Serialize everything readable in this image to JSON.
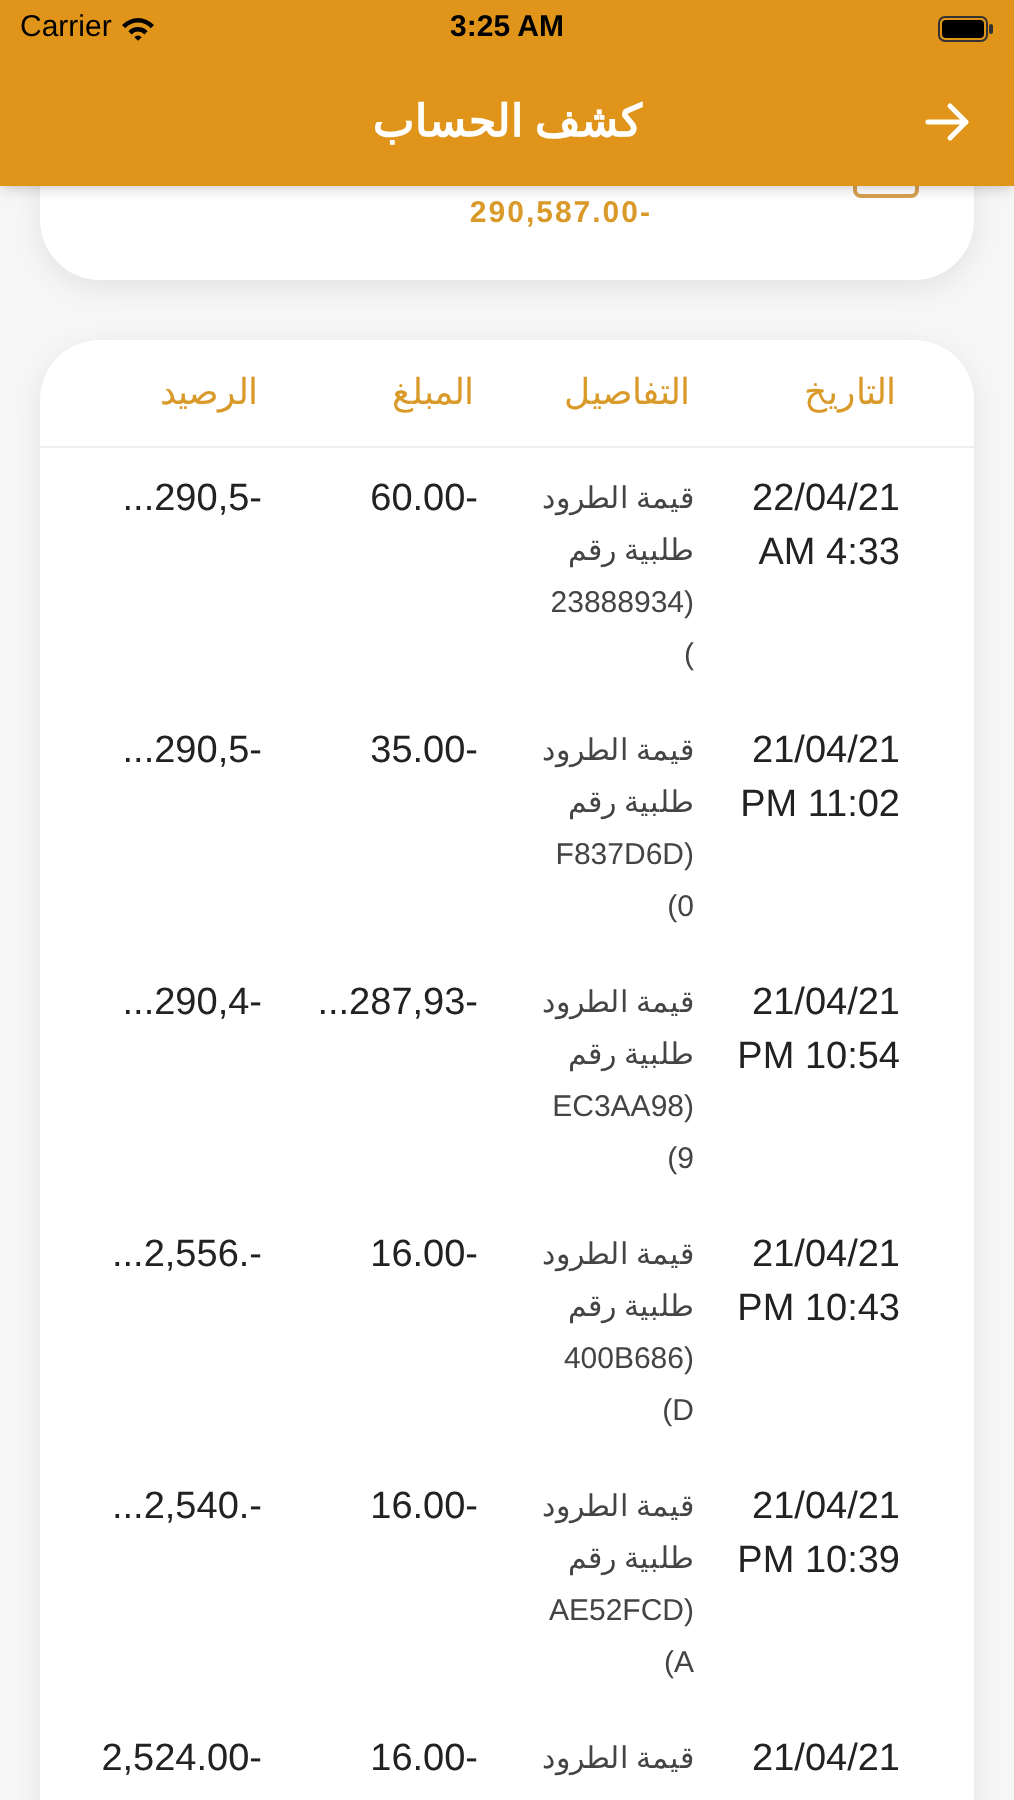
{
  "status_bar": {
    "carrier": "Carrier",
    "time": "3:25 AM"
  },
  "nav": {
    "title": "كشف الحساب"
  },
  "summary": {
    "amount": "290,587.00-"
  },
  "table": {
    "columns": [
      "التاريخ",
      "التفاصيل",
      "المبلغ",
      "الرصيد"
    ],
    "rows": [
      {
        "date": [
          "22/04/21",
          "AM 4:33"
        ],
        "details": [
          "قيمة الطرود",
          "طلبية رقم",
          "23888934)",
          "("
        ],
        "amount": "60.00-",
        "balance": "...290,5-"
      },
      {
        "date": [
          "21/04/21",
          "PM 11:02"
        ],
        "details": [
          "قيمة الطرود",
          "طلبية رقم",
          "F837D6D)",
          "(0"
        ],
        "amount": "35.00-",
        "balance": "...290,5-"
      },
      {
        "date": [
          "21/04/21",
          "PM 10:54"
        ],
        "details": [
          "قيمة الطرود",
          "طلبية رقم",
          "EC3AA98)",
          "(9"
        ],
        "amount": "...287,93-",
        "balance": "...290,4-"
      },
      {
        "date": [
          "21/04/21",
          "PM 10:43"
        ],
        "details": [
          "قيمة الطرود",
          "طلبية رقم",
          "400B686)",
          "(D"
        ],
        "amount": "16.00-",
        "balance": "...2,556.-"
      },
      {
        "date": [
          "21/04/21",
          "PM 10:39"
        ],
        "details": [
          "قيمة الطرود",
          "طلبية رقم",
          "AE52FCD)",
          "(A"
        ],
        "amount": "16.00-",
        "balance": "...2,540.-"
      },
      {
        "date": [
          "21/04/21"
        ],
        "details": [
          "قيمة الطرود"
        ],
        "amount": "16.00-",
        "balance": "2,524.00-"
      }
    ]
  }
}
